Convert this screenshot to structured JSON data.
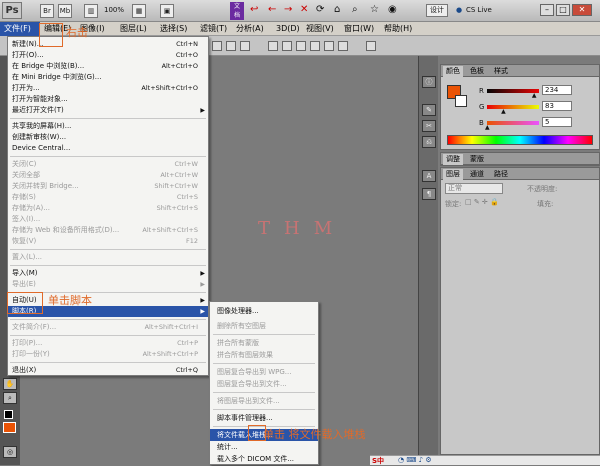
{
  "app": {
    "logo": "Ps",
    "br_label": "Br",
    "mb_label": "Mb",
    "zoom": "100%",
    "workspace": "设计",
    "cs_live": "CS Live"
  },
  "menubar": {
    "items": [
      "文件(F)",
      "编辑(E)",
      "图像(I)",
      "图层(L)",
      "选择(S)",
      "滤镜(T)",
      "分析(A)",
      "3D(D)",
      "视图(V)",
      "窗口(W)",
      "帮助(H)"
    ]
  },
  "file_menu": {
    "items": [
      {
        "label": "新建(N)...",
        "shortcut": "Ctrl+N"
      },
      {
        "label": "打开(O)...",
        "shortcut": "Ctrl+O"
      },
      {
        "label": "在 Bridge 中浏览(B)...",
        "shortcut": "Alt+Ctrl+O"
      },
      {
        "label": "在 Mini Bridge 中浏览(G)...",
        "shortcut": ""
      },
      {
        "label": "打开为...",
        "shortcut": "Alt+Shift+Ctrl+O"
      },
      {
        "label": "打开为智能对象...",
        "shortcut": ""
      },
      {
        "label": "最近打开文件(T)",
        "shortcut": ""
      },
      {
        "label": "共享我的屏幕(H)...",
        "shortcut": ""
      },
      {
        "label": "创建新审核(W)...",
        "shortcut": ""
      },
      {
        "label": "Device Central...",
        "shortcut": ""
      },
      {
        "label": "关闭(C)",
        "shortcut": "Ctrl+W"
      },
      {
        "label": "关闭全部",
        "shortcut": "Alt+Ctrl+W"
      },
      {
        "label": "关闭并转到 Bridge...",
        "shortcut": "Shift+Ctrl+W"
      },
      {
        "label": "存储(S)",
        "shortcut": "Ctrl+S"
      },
      {
        "label": "存储为(A)...",
        "shortcut": "Shift+Ctrl+S"
      },
      {
        "label": "签入(I)...",
        "shortcut": ""
      },
      {
        "label": "存储为 Web 和设备所用格式(D)...",
        "shortcut": "Alt+Shift+Ctrl+S"
      },
      {
        "label": "恢复(V)",
        "shortcut": "F12"
      },
      {
        "label": "置入(L)...",
        "shortcut": ""
      },
      {
        "label": "导入(M)",
        "shortcut": ""
      },
      {
        "label": "导出(E)",
        "shortcut": ""
      },
      {
        "label": "自动(U)",
        "shortcut": ""
      },
      {
        "label": "脚本(R)",
        "shortcut": ""
      },
      {
        "label": "文件简介(F)...",
        "shortcut": "Alt+Shift+Ctrl+I"
      },
      {
        "label": "打印(P)...",
        "shortcut": "Ctrl+P"
      },
      {
        "label": "打印一份(Y)",
        "shortcut": "Alt+Shift+Ctrl+P"
      },
      {
        "label": "退出(X)",
        "shortcut": "Ctrl+Q"
      }
    ]
  },
  "scripts_submenu": {
    "items": [
      "图像处理器...",
      "删除所有空图层",
      "拼合所有蒙版",
      "拼合所有图层效果",
      "图层复合导出到 WPG...",
      "图层复合导出到文件...",
      "将图层导出到文件...",
      "脚本事件管理器...",
      "将文件载入堆栈...",
      "统计...",
      "载入多个 DICOM 文件..."
    ]
  },
  "color_panel": {
    "tabs": [
      "颜色",
      "色板",
      "样式"
    ],
    "r_label": "R",
    "g_label": "G",
    "b_label": "B",
    "r": "234",
    "g": "83",
    "b": "5",
    "r_frac": 0.92,
    "g_frac": 0.33,
    "b_frac": 0.02,
    "fg_color": "#ea5305"
  },
  "adjust_panel": {
    "tabs": [
      "调整",
      "蒙版"
    ]
  },
  "layers_panel": {
    "tabs": [
      "图层",
      "通道",
      "路径"
    ],
    "blend_mode": "正常",
    "opacity_label": "不透明度:",
    "lock_label": "锁定:",
    "fill_label": "填充:"
  },
  "annotations": {
    "right_click": "右击",
    "click_script": "单击脚本",
    "click_load": "单击 将文件载入堆栈",
    "watermark": "THM"
  },
  "taskbar": {
    "ime": "S中"
  },
  "colors": {
    "accent": "#e06a2a",
    "highlight": "#2a54a8"
  }
}
